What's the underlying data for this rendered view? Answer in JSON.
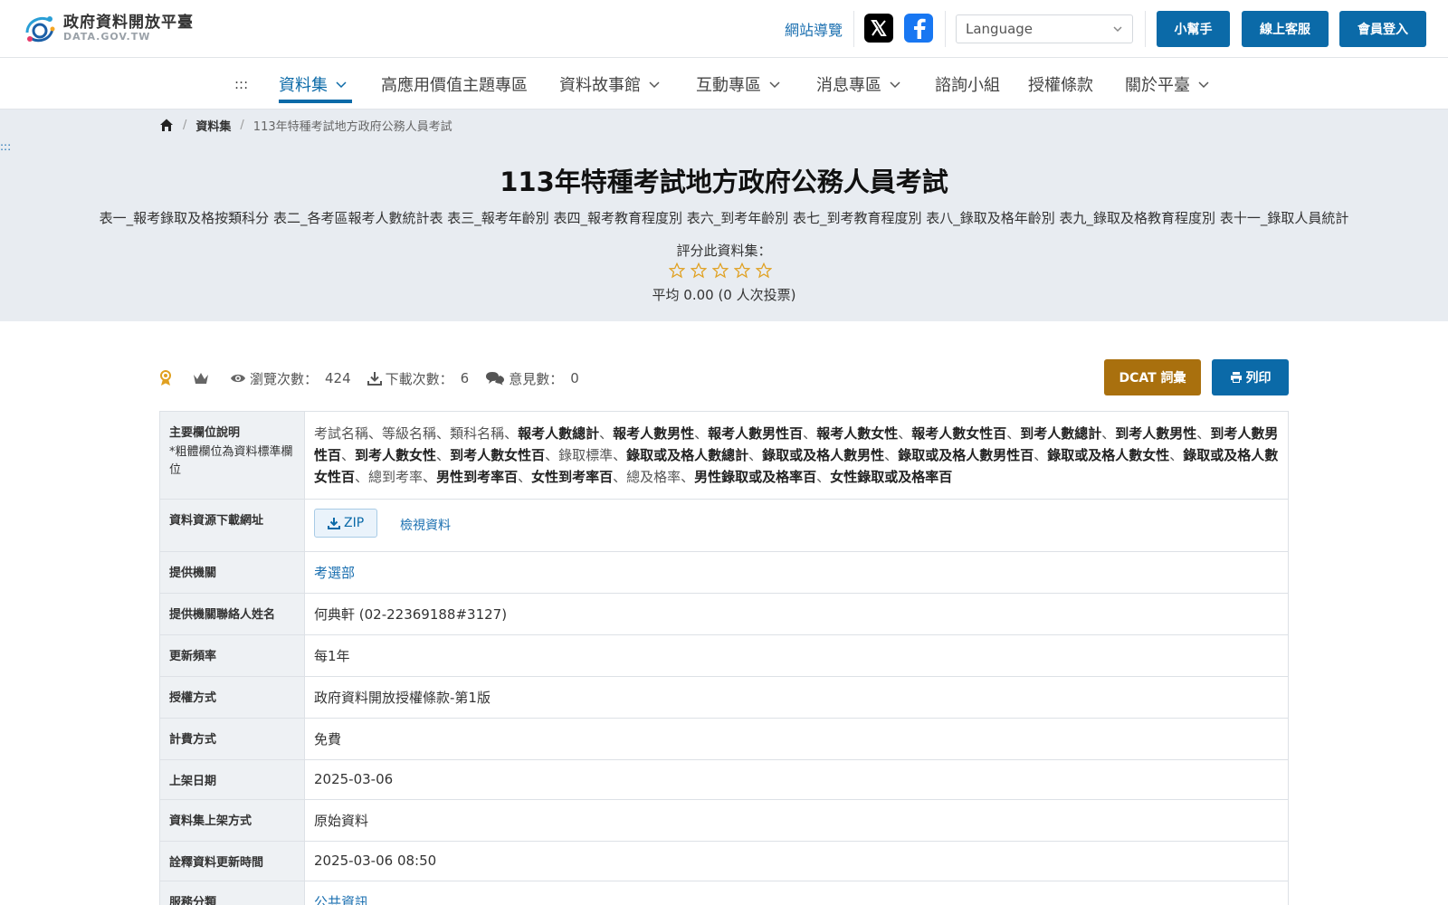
{
  "site": {
    "logo_cn": "政府資料開放平臺",
    "logo_en": "DATA.GOV.TW"
  },
  "header": {
    "sitemap": "網站導覽",
    "language_placeholder": "Language",
    "buttons": [
      "小幫手",
      "線上客服",
      "會員登入"
    ]
  },
  "nav": {
    "anchor": ":::",
    "items": [
      "資料集",
      "高應用價值主題專區",
      "資料故事館",
      "互動專區",
      "消息專區",
      "諮詢小組",
      "授權條款",
      "關於平臺"
    ]
  },
  "breadcrumb": {
    "level1": "資料集",
    "level2": "113年特種考試地方政府公務人員考試"
  },
  "side_anchor": ":::",
  "dataset": {
    "title": "113年特種考試地方政府公務人員考試",
    "description": "表一_報考錄取及格按類科分 表二_各考區報考人數統計表 表三_報考年齡別 表四_報考教育程度別 表六_到考年齡別 表七_到考教育程度別 表八_錄取及格年齡別 表九_錄取及格教育程度別 表十一_錄取人員統計",
    "rate_label": "評分此資料集：",
    "rating_stars": 0,
    "rating_avg": "平均 0.00 (0 人次投票)"
  },
  "stats": {
    "views_label": "瀏覽次數：",
    "views": "424",
    "downloads_label": "下載次數：",
    "downloads": "6",
    "comments_label": "意見數：",
    "comments": "0"
  },
  "actions": {
    "dcat": "DCAT 詞彙",
    "print": "列印"
  },
  "info": {
    "fields_label": "主要欄位說明",
    "fields_note": "*粗體欄位為資料標準欄位",
    "fields": [
      {
        "t": "考試名稱",
        "b": false
      },
      {
        "t": "等級名稱",
        "b": false
      },
      {
        "t": "類科名稱",
        "b": false
      },
      {
        "t": "報考人數總計",
        "b": true
      },
      {
        "t": "報考人數男性",
        "b": true
      },
      {
        "t": "報考人數男性百",
        "b": true
      },
      {
        "t": "報考人數女性",
        "b": true
      },
      {
        "t": "報考人數女性百",
        "b": true
      },
      {
        "t": "到考人數總計",
        "b": true
      },
      {
        "t": "到考人數男性",
        "b": true
      },
      {
        "t": "到考人數男性百",
        "b": true
      },
      {
        "t": "到考人數女性",
        "b": true
      },
      {
        "t": "到考人數女性百",
        "b": true
      },
      {
        "t": "錄取標準",
        "b": false
      },
      {
        "t": "錄取或及格人數總計",
        "b": true
      },
      {
        "t": "錄取或及格人數男性",
        "b": true
      },
      {
        "t": "錄取或及格人數男性百",
        "b": true
      },
      {
        "t": "錄取或及格人數女性",
        "b": true
      },
      {
        "t": "錄取或及格人數女性百",
        "b": true
      },
      {
        "t": "總到考率",
        "b": false
      },
      {
        "t": "男性到考率百",
        "b": true
      },
      {
        "t": "女性到考率百",
        "b": true
      },
      {
        "t": "總及格率",
        "b": false
      },
      {
        "t": "男性錄取或及格率百",
        "b": true
      },
      {
        "t": "女性錄取或及格率百",
        "b": true
      }
    ],
    "download_label": "資料資源下載網址",
    "download_format": "ZIP",
    "view_data": "檢視資料",
    "agency_label": "提供機關",
    "agency": "考選部",
    "contact_label": "提供機關聯絡人姓名",
    "contact": "何典軒 (02-22369188#3127)",
    "frequency_label": "更新頻率",
    "frequency": "每1年",
    "license_label": "授權方式",
    "license": "政府資料開放授權條款-第1版",
    "fee_label": "計費方式",
    "fee": "免費",
    "published_label": "上架日期",
    "published": "2025-03-06",
    "method_label": "資料集上架方式",
    "method": "原始資料",
    "metadata_updated_label": "詮釋資料更新時間",
    "metadata_updated": "2025-03-06 08:50",
    "category_label": "服務分類",
    "category": "公共資訊"
  }
}
